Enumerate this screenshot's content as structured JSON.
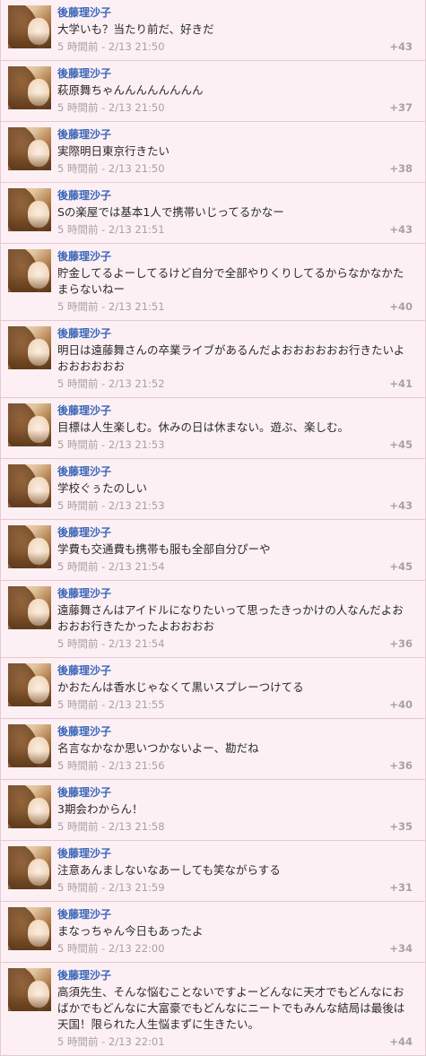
{
  "posts": [
    {
      "author": "後藤理沙子",
      "text": "大学いも？当たり前だ、好きだ",
      "time": "5 時間前 - 2/13 21:50",
      "count": "+43"
    },
    {
      "author": "後藤理沙子",
      "text": "萩原舞ちゃんんんんんんんん",
      "time": "5 時間前 - 2/13 21:50",
      "count": "+37"
    },
    {
      "author": "後藤理沙子",
      "text": "実際明日東京行きたい",
      "time": "5 時間前 - 2/13 21:50",
      "count": "+38"
    },
    {
      "author": "後藤理沙子",
      "text": "Sの楽屋では基本1人で携帯いじってるかなー",
      "time": "5 時間前 - 2/13 21:51",
      "count": "+43"
    },
    {
      "author": "後藤理沙子",
      "text": "貯金してるよーしてるけど自分で全部やりくりしてるからなかなかたまらないねー",
      "time": "5 時間前 - 2/13 21:51",
      "count": "+40"
    },
    {
      "author": "後藤理沙子",
      "text": "明日は遠藤舞さんの卒業ライブがあるんだよおおおおおお行きたいよおおおおおお",
      "time": "5 時間前 - 2/13 21:52",
      "count": "+41"
    },
    {
      "author": "後藤理沙子",
      "text": "目標は人生楽しむ。休みの日は休まない。遊ぶ、楽しむ。",
      "time": "5 時間前 - 2/13 21:53",
      "count": "+45"
    },
    {
      "author": "後藤理沙子",
      "text": "学校ぐぅたのしい",
      "time": "5 時間前 - 2/13 21:53",
      "count": "+43"
    },
    {
      "author": "後藤理沙子",
      "text": "学費も交通費も携帯も服も全部自分ぴーや",
      "time": "5 時間前 - 2/13 21:54",
      "count": "+45"
    },
    {
      "author": "後藤理沙子",
      "text": "遠藤舞さんはアイドルになりたいって思ったきっかけの人なんだよおおおお行きたかったよおおおお",
      "time": "5 時間前 - 2/13 21:54",
      "count": "+36"
    },
    {
      "author": "後藤理沙子",
      "text": "かおたんは香水じゃなくて黒いスプレーつけてる",
      "time": "5 時間前 - 2/13 21:55",
      "count": "+40"
    },
    {
      "author": "後藤理沙子",
      "text": "名言なかなか思いつかないよー、勘だね",
      "time": "5 時間前 - 2/13 21:56",
      "count": "+36"
    },
    {
      "author": "後藤理沙子",
      "text": "3期会わからん！",
      "time": "5 時間前 - 2/13 21:58",
      "count": "+35"
    },
    {
      "author": "後藤理沙子",
      "text": "注意あんましないなあーしても笑ながらする",
      "time": "5 時間前 - 2/13 21:59",
      "count": "+31"
    },
    {
      "author": "後藤理沙子",
      "text": "まなっちゃん今日もあったよ",
      "time": "5 時間前 - 2/13 22:00",
      "count": "+34"
    },
    {
      "author": "後藤理沙子",
      "text": "高須先生、そんな悩むことないですよーどんなに天才でもどんなにおばかでもどんなに大富豪でもどんなにニートでもみんな結局は最後は天国！限られた人生悩まずに生きたい。",
      "time": "5 時間前 - 2/13 22:01",
      "count": "+44"
    }
  ]
}
